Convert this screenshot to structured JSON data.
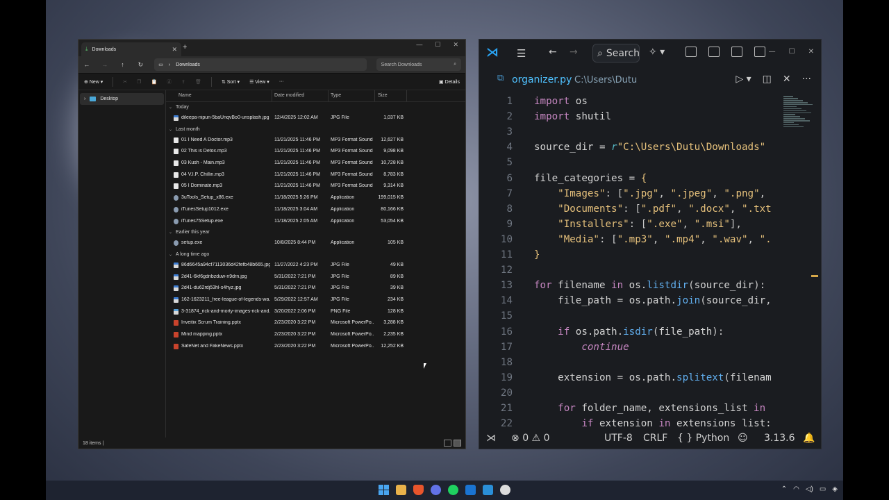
{
  "explorer": {
    "tab_label": "Downloads",
    "new_tab": "+",
    "path": "Downloads",
    "search_placeholder": "Search Downloads",
    "cmd": {
      "new": "New",
      "sort": "Sort",
      "view": "View",
      "more": "···",
      "details": "Details"
    },
    "columns": [
      "Name",
      "Date modified",
      "Type",
      "Size"
    ],
    "sidebar": [
      {
        "label": "Desktop"
      }
    ],
    "groups": [
      {
        "label": "Today",
        "files": [
          {
            "name": "dileepa-nipun-5baUnqvBo0-unsplash.jpg",
            "date": "12/4/2025 12:02 AM",
            "type": "JPG File",
            "size": "1,037 KB",
            "kind": "jpg"
          }
        ]
      },
      {
        "label": "Last month",
        "files": [
          {
            "name": "01 I Need A Doctor.mp3",
            "date": "11/21/2025 11:46 PM",
            "type": "MP3 Format Sound",
            "size": "12,627 KB",
            "kind": "mp3"
          },
          {
            "name": "02 This is Detox.mp3",
            "date": "11/21/2025 11:46 PM",
            "type": "MP3 Format Sound",
            "size": "9,098 KB",
            "kind": "mp3"
          },
          {
            "name": "03 Kush - Main.mp3",
            "date": "11/21/2025 11:46 PM",
            "type": "MP3 Format Sound",
            "size": "10,728 KB",
            "kind": "mp3"
          },
          {
            "name": "04 V.I.P. Chillin.mp3",
            "date": "11/21/2025 11:46 PM",
            "type": "MP3 Format Sound",
            "size": "8,783 KB",
            "kind": "mp3"
          },
          {
            "name": "05 I Dominate.mp3",
            "date": "11/21/2025 11:46 PM",
            "type": "MP3 Format Sound",
            "size": "9,314 KB",
            "kind": "mp3"
          },
          {
            "name": "3uTools_Setup_x86.exe",
            "date": "11/18/2025 5:26 PM",
            "type": "Application",
            "size": "199,015 KB",
            "kind": "exe"
          },
          {
            "name": "iTunesSetup1012.exe",
            "date": "11/18/2025 3:04 AM",
            "type": "Application",
            "size": "80,166 KB",
            "kind": "exe"
          },
          {
            "name": "iTunes75Setup.exe",
            "date": "11/18/2025 2:05 AM",
            "type": "Application",
            "size": "53,054 KB",
            "kind": "exe"
          }
        ]
      },
      {
        "label": "Earlier this year",
        "files": [
          {
            "name": "setup.exe",
            "date": "10/8/2025 8:44 PM",
            "type": "Application",
            "size": "105 KB",
            "kind": "exe"
          }
        ]
      },
      {
        "label": "A long time ago",
        "files": [
          {
            "name": "86d6645a94cf7113036d42fefb48b665.jpg",
            "date": "11/27/2022 4:23 PM",
            "type": "JPG File",
            "size": "49 KB",
            "kind": "jpg"
          },
          {
            "name": "2d41-6kf6gdnbzduw-n9drn.jpg",
            "date": "5/31/2022 7:21 PM",
            "type": "JPG File",
            "size": "89 KB",
            "kind": "jpg"
          },
          {
            "name": "2d41-du62rdj53hl-s4hyz.jpg",
            "date": "5/31/2022 7:21 PM",
            "type": "JPG File",
            "size": "39 KB",
            "kind": "jpg"
          },
          {
            "name": "162-1623211_free-league-of-legends-wa...",
            "date": "5/29/2022 12:57 AM",
            "type": "JPG File",
            "size": "234 KB",
            "kind": "jpg"
          },
          {
            "name": "3-31874_rick-and-morty-images-rick-and...",
            "date": "3/20/2022 2:06 PM",
            "type": "PNG File",
            "size": "128 KB",
            "kind": "png"
          },
          {
            "name": "Inveitix Scrum Training.pptx",
            "date": "2/23/2020 3:22 PM",
            "type": "Microsoft PowerPo...",
            "size": "3,288 KB",
            "kind": "ppt"
          },
          {
            "name": "Mind mapping.pptx",
            "date": "2/23/2020 3:22 PM",
            "type": "Microsoft PowerPo...",
            "size": "2,235 KB",
            "kind": "ppt"
          },
          {
            "name": "SafeNet and FakeNews.pptx",
            "date": "2/23/2020 3:22 PM",
            "type": "Microsoft PowerPo...",
            "size": "12,252 KB",
            "kind": "ppt"
          }
        ]
      }
    ],
    "status": "18 items  |"
  },
  "vscode": {
    "search_label": "Search",
    "tab_name": "organizer.py",
    "tab_path": "C:\\Users\\Dutu",
    "lines": [
      [
        [
          "kw",
          "import"
        ],
        [
          "var",
          " os"
        ]
      ],
      [
        [
          "kw",
          "import"
        ],
        [
          "var",
          " shutil"
        ]
      ],
      [],
      [
        [
          "var",
          "source_dir "
        ],
        [
          "pun",
          "= "
        ],
        [
          "rprefix",
          "r"
        ],
        [
          "str",
          "\"C:\\Users\\Dutu\\Downloads\""
        ]
      ],
      [],
      [
        [
          "var",
          "file_categories "
        ],
        [
          "pun",
          "= "
        ],
        [
          "brace",
          "{"
        ]
      ],
      [
        [
          "str",
          "    \"Images\""
        ],
        [
          "pun",
          ": ["
        ],
        [
          "str",
          "\".jpg\""
        ],
        [
          "pun",
          ", "
        ],
        [
          "str",
          "\".jpeg\""
        ],
        [
          "pun",
          ", "
        ],
        [
          "str",
          "\".png\""
        ],
        [
          "pun",
          ","
        ]
      ],
      [
        [
          "str",
          "    \"Documents\""
        ],
        [
          "pun",
          ": ["
        ],
        [
          "str",
          "\".pdf\""
        ],
        [
          "pun",
          ", "
        ],
        [
          "str",
          "\".docx\""
        ],
        [
          "pun",
          ", "
        ],
        [
          "str",
          "\".txt"
        ]
      ],
      [
        [
          "str",
          "    \"Installers\""
        ],
        [
          "pun",
          ": ["
        ],
        [
          "str",
          "\".exe\""
        ],
        [
          "pun",
          ", "
        ],
        [
          "str",
          "\".msi\""
        ],
        [
          "pun",
          "],"
        ]
      ],
      [
        [
          "str",
          "    \"Media\""
        ],
        [
          "pun",
          ": ["
        ],
        [
          "str",
          "\".mp3\""
        ],
        [
          "pun",
          ", "
        ],
        [
          "str",
          "\".mp4\""
        ],
        [
          "pun",
          ", "
        ],
        [
          "str",
          "\".wav\""
        ],
        [
          "pun",
          ", "
        ],
        [
          "str",
          "\"."
        ]
      ],
      [
        [
          "brace",
          "}"
        ]
      ],
      [],
      [
        [
          "kw",
          "for"
        ],
        [
          "var",
          " filename "
        ],
        [
          "kw",
          "in"
        ],
        [
          "var",
          " os."
        ],
        [
          "fn",
          "listdir"
        ],
        [
          "pun",
          "("
        ],
        [
          "var",
          "source_dir"
        ],
        [
          "pun",
          "):"
        ]
      ],
      [
        [
          "var",
          "    file_path "
        ],
        [
          "pun",
          "= "
        ],
        [
          "var",
          "os.path."
        ],
        [
          "fn",
          "join"
        ],
        [
          "pun",
          "("
        ],
        [
          "var",
          "source_dir"
        ],
        [
          "pun",
          ","
        ]
      ],
      [],
      [
        [
          "kw",
          "    if"
        ],
        [
          "var",
          " os.path."
        ],
        [
          "fn",
          "isdir"
        ],
        [
          "pun",
          "("
        ],
        [
          "var",
          "file_path"
        ],
        [
          "pun",
          "):"
        ]
      ],
      [
        [
          "it",
          "        continue"
        ]
      ],
      [],
      [
        [
          "var",
          "    extension "
        ],
        [
          "pun",
          "= "
        ],
        [
          "var",
          "os.path."
        ],
        [
          "fn",
          "splitext"
        ],
        [
          "pun",
          "("
        ],
        [
          "var",
          "filenam"
        ]
      ],
      [],
      [
        [
          "kw",
          "    for"
        ],
        [
          "var",
          " folder_name, extensions_list "
        ],
        [
          "kw",
          "in"
        ]
      ],
      [
        [
          "kw",
          "        if"
        ],
        [
          "var",
          " extension "
        ],
        [
          "kw",
          "in"
        ],
        [
          "var",
          " extensions_list:"
        ]
      ]
    ],
    "status": {
      "errors": "0",
      "warnings": "0",
      "encoding": "UTF-8",
      "eol": "CRLF",
      "language": "Python",
      "version": "3.13.6"
    }
  }
}
